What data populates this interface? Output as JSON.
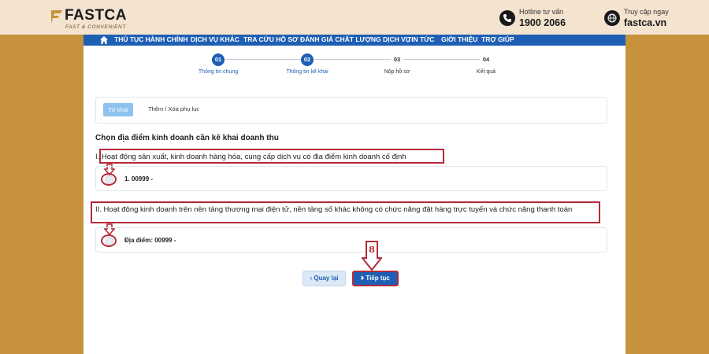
{
  "brand": {
    "name": "FASTCA",
    "tagline": "FAST & CONVENIENT",
    "accent_color": "#1e5fb4",
    "highlight_color": "#b42b3a"
  },
  "contacts": [
    {
      "icon": "phone-icon",
      "label": "Hotline tư vấn",
      "value": "1900 2066"
    },
    {
      "icon": "globe-icon",
      "label": "Truy cập ngay",
      "value": "fastca.vn"
    }
  ],
  "nav": {
    "items": [
      "THỦ TỤC HÀNH CHÍNH",
      "DỊCH VỤ KHÁC",
      "TRA CỨU HỒ SƠ",
      "ĐÁNH GIÁ CHẤT LƯỢNG DỊCH VỤ",
      "TIN TỨC",
      "GIỚI THIỆU",
      "TRỢ GIÚP"
    ]
  },
  "stepper": [
    {
      "num": "01",
      "label": "Thông tin chung",
      "state": "active"
    },
    {
      "num": "02",
      "label": "Thông tin kê khai",
      "state": "active"
    },
    {
      "num": "03",
      "label": "Nộp hồ sơ",
      "state": "todo"
    },
    {
      "num": "04",
      "label": "Kết quả",
      "state": "todo"
    }
  ],
  "tabs": {
    "active": "Tờ khai",
    "other": "Thêm / Xóa phụ lục"
  },
  "heading": "Chọn địa điểm kinh doanh cần kê khai doanh thu",
  "sections": [
    {
      "title": "I. Hoạt động sản xuất, kinh doanh hàng hóa, cung cấp dịch vụ có địa điểm kinh doanh cố định",
      "option": "1. 00999 -"
    },
    {
      "title": "II. Hoạt động kinh doanh trên nền tảng thương mại điện tử, nền tảng số khác không có chức năng đặt hàng trực tuyến và chức năng thanh toán",
      "option": "Địa điểm: 00999 -"
    }
  ],
  "buttons": {
    "back": "Quay lại",
    "next": "Tiếp tục"
  },
  "annotation_step": "8"
}
